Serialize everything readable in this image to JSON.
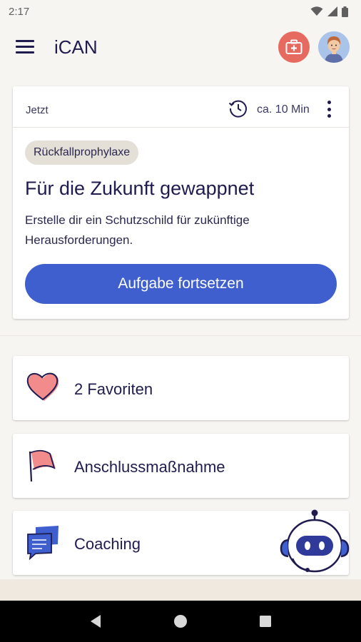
{
  "status_bar": {
    "time": "2:17"
  },
  "app_bar": {
    "title": "iCAN"
  },
  "task_card": {
    "when": "Jetzt",
    "duration": "ca. 10 Min",
    "tag": "Rückfallprophylaxe",
    "title": "Für die Zukunft gewappnet",
    "description": "Erstelle dir ein Schutzschild für zukünftige Herausforderungen.",
    "button_label": "Aufgabe fortsetzen"
  },
  "list": [
    {
      "label": "2 Favoriten",
      "icon": "heart-icon"
    },
    {
      "label": "Anschlussmaßnahme",
      "icon": "flag-icon"
    },
    {
      "label": "Coaching",
      "icon": "chat-bubbles-icon"
    }
  ],
  "colors": {
    "primary": "#3f5fcf",
    "emergency": "#e66a5f",
    "text": "#1f1b4f",
    "background": "#f7f5f2",
    "chip": "#e4e0d8"
  }
}
